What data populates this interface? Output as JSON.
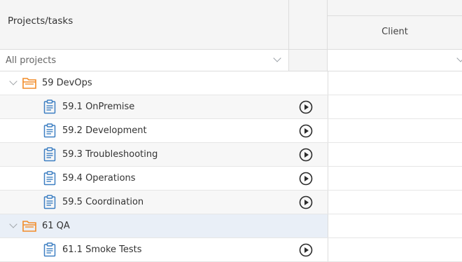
{
  "header": {
    "projects_label": "Projects/tasks",
    "client_label": "Client"
  },
  "filter": {
    "projects_value": "All projects",
    "client_value": ""
  },
  "colors": {
    "folder": "#f28c28",
    "task_icon": "#3d7fc2",
    "play_icon": "#2b2b2b",
    "selected_row": "#e9eff7"
  },
  "rows": [
    {
      "type": "project",
      "label": "59 DevOps",
      "icon": "folder-icon"
    },
    {
      "type": "task",
      "label": "59.1 OnPremise",
      "icon": "clipboard-icon"
    },
    {
      "type": "task",
      "label": "59.2 Development",
      "icon": "clipboard-icon"
    },
    {
      "type": "task",
      "label": "59.3 Troubleshooting",
      "icon": "clipboard-icon"
    },
    {
      "type": "task",
      "label": "59.4 Operations",
      "icon": "clipboard-icon"
    },
    {
      "type": "task",
      "label": "59.5 Coordination",
      "icon": "clipboard-icon"
    },
    {
      "type": "project",
      "label": "61 QA",
      "icon": "folder-icon"
    },
    {
      "type": "task",
      "label": "61.1 Smoke Tests",
      "icon": "clipboard-icon"
    }
  ]
}
